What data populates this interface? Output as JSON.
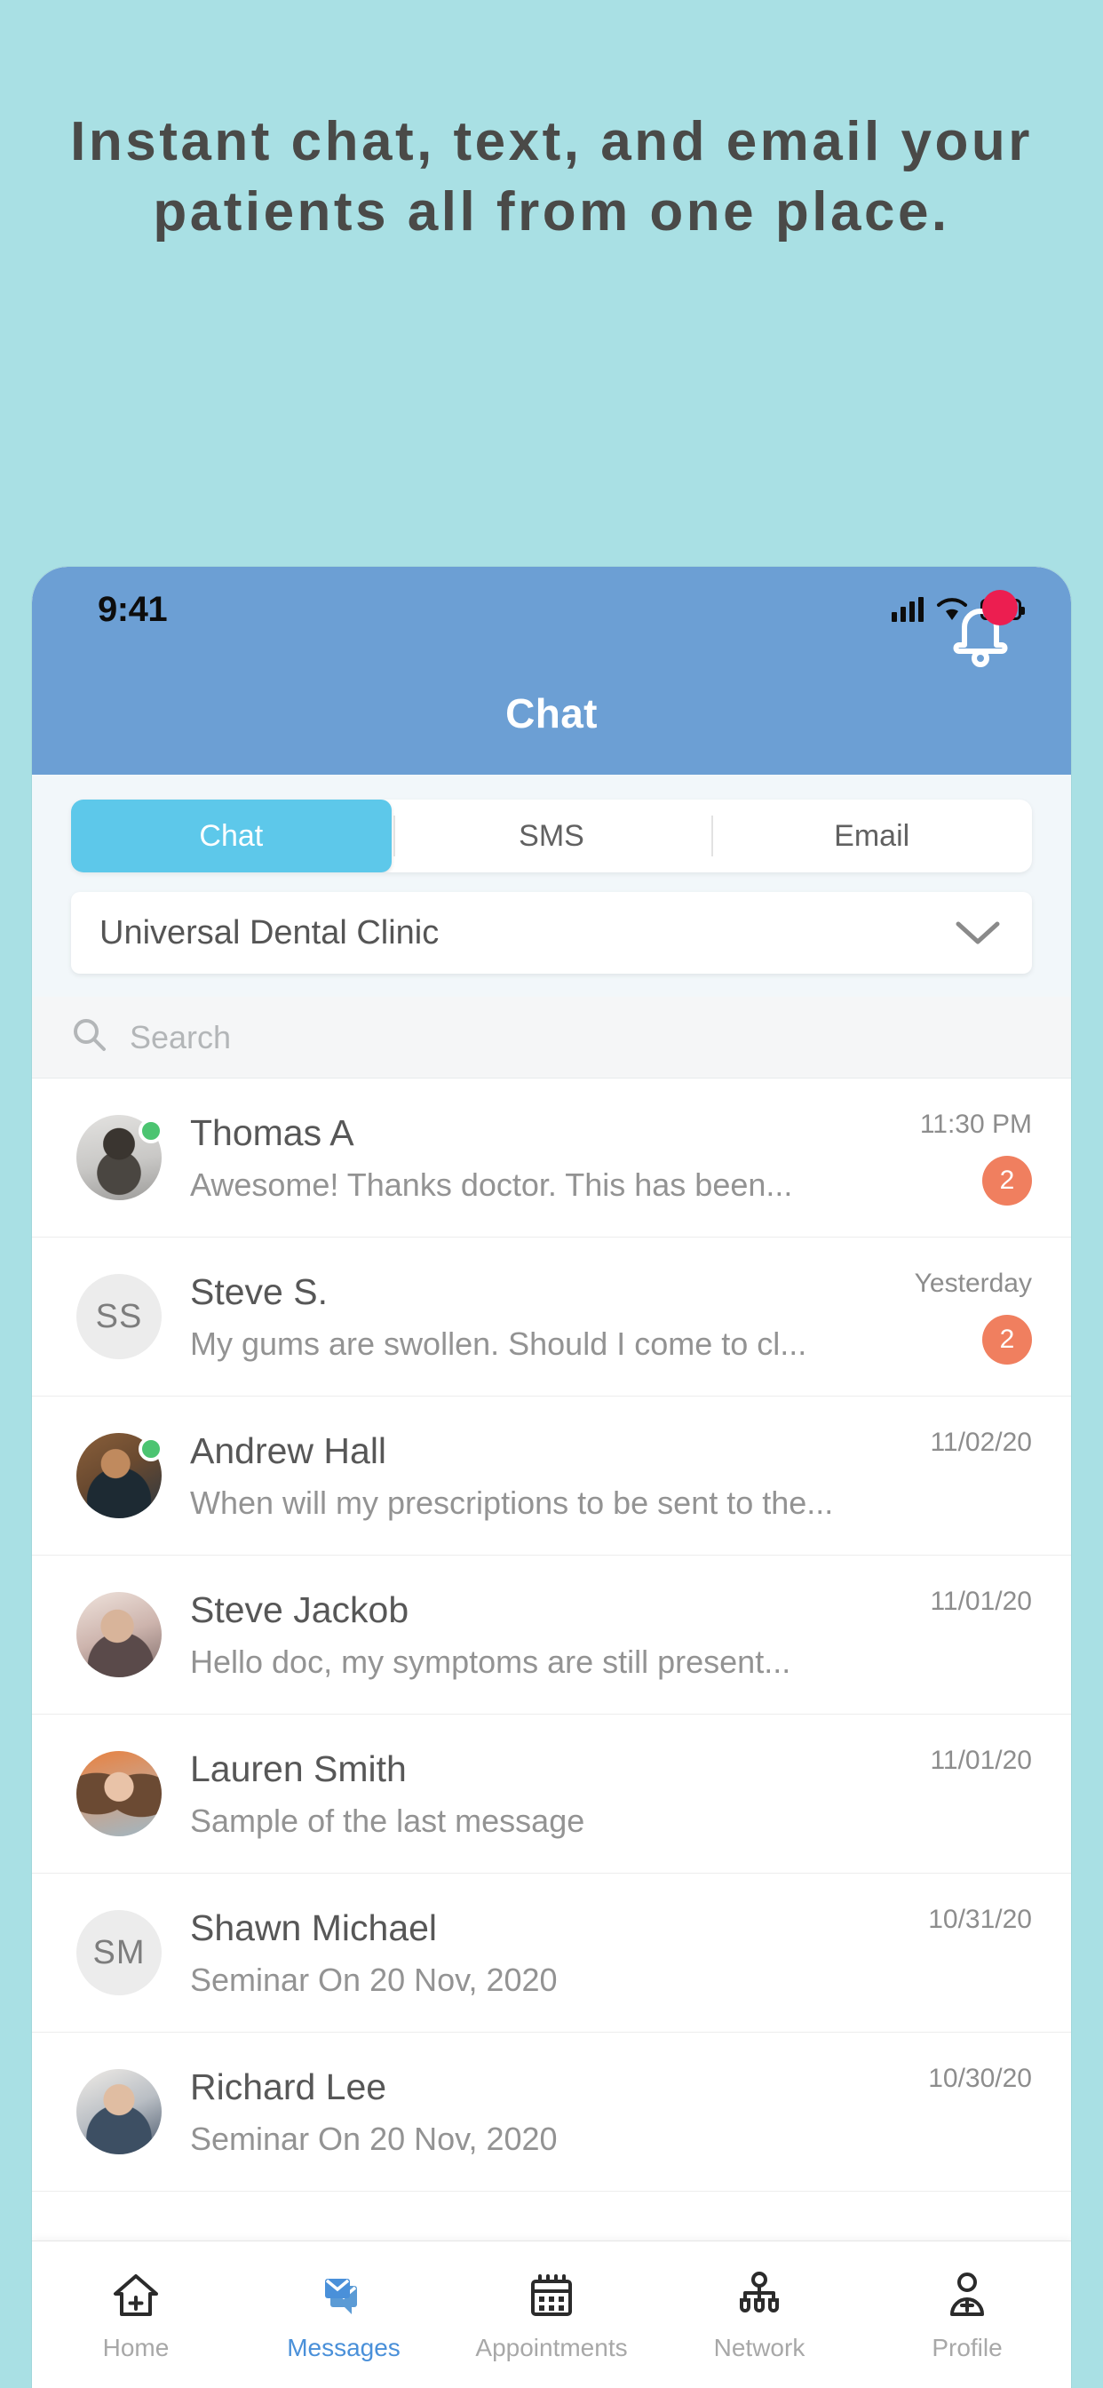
{
  "promo": {
    "headline": "Instant chat, text, and email your patients all from one place.",
    "background_color": "#a9e0e4",
    "text_color": "#4a4a48"
  },
  "status_bar": {
    "time": "9:41",
    "icons": [
      "cellular-signal-icon",
      "wifi-icon",
      "battery-icon"
    ]
  },
  "header": {
    "title": "Chat",
    "background_color": "#6c9fd4",
    "notification_icon": "bell-icon",
    "notification_dot_color": "#ec1e50"
  },
  "tabs": [
    {
      "label": "Chat",
      "active": true
    },
    {
      "label": "SMS",
      "active": false
    },
    {
      "label": "Email",
      "active": false
    }
  ],
  "tab_active_color": "#5dc8ea",
  "clinic_select": {
    "value": "Universal Dental Clinic",
    "chevron": "chevron-down-icon"
  },
  "search": {
    "placeholder": "Search",
    "icon": "search-icon",
    "value": ""
  },
  "conversations": [
    {
      "name": "Thomas A",
      "preview": "Awesome! Thanks doctor. This has been...",
      "time": "11:30 PM",
      "badge": "2",
      "online": true,
      "avatar_type": "photo",
      "initials": ""
    },
    {
      "name": "Steve S.",
      "preview": "My gums are swollen. Should I come to cl...",
      "time": "Yesterday",
      "badge": "2",
      "online": false,
      "avatar_type": "initials",
      "initials": "SS"
    },
    {
      "name": "Andrew Hall",
      "preview": "When will my prescriptions to be sent to the...",
      "time": "11/02/20",
      "badge": "",
      "online": true,
      "avatar_type": "photo",
      "initials": ""
    },
    {
      "name": "Steve Jackob",
      "preview": "Hello doc, my symptoms are still present...",
      "time": "11/01/20",
      "badge": "",
      "online": false,
      "avatar_type": "photo",
      "initials": ""
    },
    {
      "name": "Lauren Smith",
      "preview": "Sample of the last message",
      "time": "11/01/20",
      "badge": "",
      "online": false,
      "avatar_type": "photo",
      "initials": ""
    },
    {
      "name": "Shawn Michael",
      "preview": "Seminar On 20 Nov, 2020",
      "time": "10/31/20",
      "badge": "",
      "online": false,
      "avatar_type": "initials",
      "initials": "SM"
    },
    {
      "name": "Richard Lee",
      "preview": "Seminar On 20 Nov, 2020",
      "time": "10/30/20",
      "badge": "",
      "online": false,
      "avatar_type": "photo",
      "initials": ""
    }
  ],
  "badge_color": "#f07f5f",
  "online_color": "#4cc471",
  "bottom_nav": {
    "active_color": "#4a90d9",
    "inactive_color": "#a8a8a8",
    "items": [
      {
        "label": "Home",
        "icon": "home-medical-icon",
        "active": false
      },
      {
        "label": "Messages",
        "icon": "messages-icon",
        "active": true
      },
      {
        "label": "Appointments",
        "icon": "calendar-icon",
        "active": false
      },
      {
        "label": "Network",
        "icon": "network-icon",
        "active": false
      },
      {
        "label": "Profile",
        "icon": "profile-medical-icon",
        "active": false
      }
    ]
  }
}
